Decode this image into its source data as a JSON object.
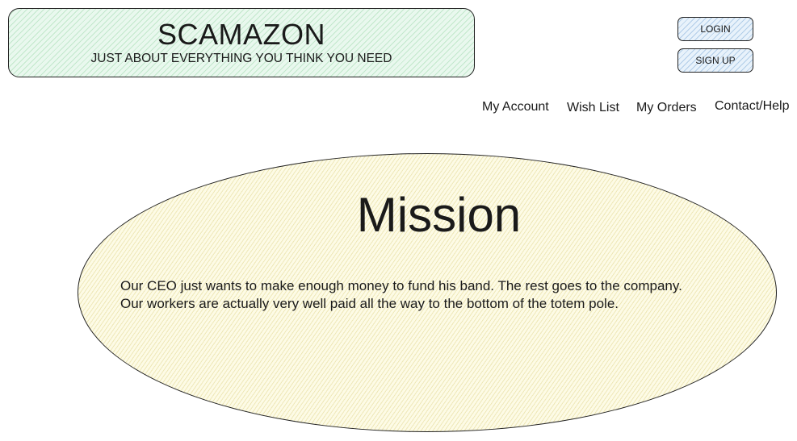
{
  "header": {
    "brand": "SCAMAZON",
    "tagline": "JUST ABOUT EVERYTHING YOU THINK YOU NEED"
  },
  "auth": {
    "login_label": "LOGIN",
    "signup_label": "SIGN UP"
  },
  "nav": {
    "my_account": "My Account",
    "wish_list": "Wish List",
    "my_orders": "My Orders",
    "contact_help": "Contact/Help"
  },
  "mission": {
    "title": "Mission",
    "line1": "Our CEO just wants to make enough money to fund his band. The rest goes to the company.",
    "line2": "Our workers are actually very well paid all the way to the bottom of the totem pole."
  },
  "colors": {
    "banner_fill": "#e9f8ee",
    "button_fill": "#e8f2fb",
    "mission_fill": "#fdfbe6"
  }
}
